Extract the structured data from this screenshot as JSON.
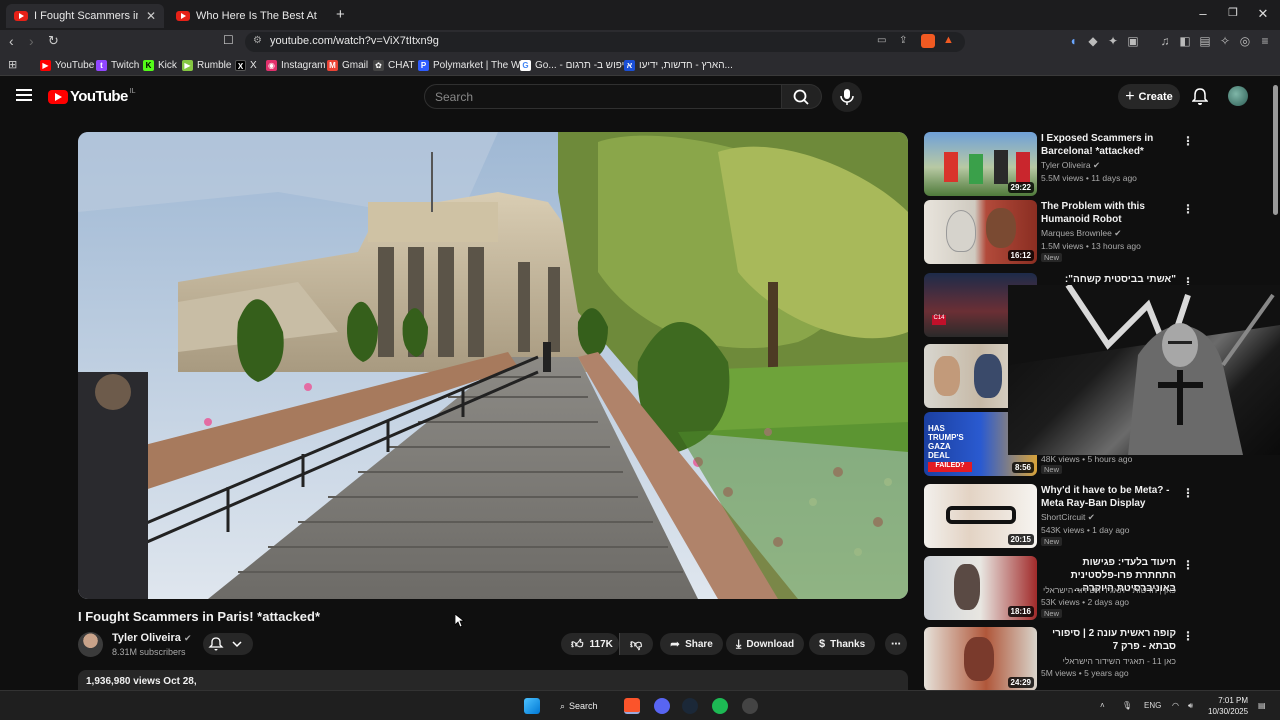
{
  "browser": {
    "tabs": [
      {
        "title": "I Fought Scammers in Paris! *",
        "active": true
      },
      {
        "title": "Who Here Is The Best At Basketball?",
        "active": false
      }
    ],
    "new_tab_glyph": "+",
    "url": "youtube.com/watch?v=ViX7tItxn9g",
    "bookmarks": [
      {
        "label": "YouTube",
        "icon": "youtube-icon",
        "color": "#ff0000"
      },
      {
        "label": "Twitch",
        "icon": "twitch-icon",
        "color": "#9146ff"
      },
      {
        "label": "Kick",
        "icon": "kick-icon",
        "color": "#53fc18"
      },
      {
        "label": "Rumble",
        "icon": "rumble-icon",
        "color": "#85c742"
      },
      {
        "label": "X",
        "icon": "x-icon",
        "color": "#000000"
      },
      {
        "label": "Instagram",
        "icon": "instagram-icon",
        "color": "#e1306c"
      },
      {
        "label": "Gmail",
        "icon": "gmail-icon",
        "color": "#ea4335"
      },
      {
        "label": "CHAT",
        "icon": "openai-icon",
        "color": "#444444"
      },
      {
        "label": "Polymarket | The W...",
        "icon": "polymarket-icon",
        "color": "#2e5cff"
      },
      {
        "label": "Go... - חיפוש ב- תרגום",
        "icon": "google-icon",
        "color": "#ffffff"
      },
      {
        "label": "הארץ - חדשות, ידיעו...",
        "icon": "haaretz-icon",
        "color": "#1a4fd6"
      }
    ]
  },
  "yt": {
    "logo_text": "YouTube",
    "country_code": "IL",
    "search_placeholder": "Search",
    "create_label": "Create"
  },
  "video": {
    "title": "I Fought Scammers in Paris! *attacked*",
    "channel": "Tyler Oliveira",
    "subscribers": "8.31M subscribers",
    "likes": "117K",
    "share_label": "Share",
    "download_label": "Download",
    "thanks_label": "Thanks",
    "views_date": "1,936,980 views  Oct 28,"
  },
  "recommendations": [
    {
      "title": "I Exposed Scammers in Barcelona! *attacked*",
      "channel": "Tyler Oliveira",
      "meta": "5.5M views • 11 days ago",
      "duration": "29:22",
      "new": false,
      "rtl": false
    },
    {
      "title": "The Problem with this Humanoid Robot",
      "channel": "Marques Brownlee",
      "meta": "1.5M views • 13 hours ago",
      "duration": "16:12",
      "new": true,
      "rtl": false
    },
    {
      "title": "\"אשתי בביסטית קשחה\": מאיר ענב...",
      "channel": "",
      "meta": "",
      "duration": "",
      "new": false,
      "rtl": true
    },
    {
      "title": "",
      "channel": "",
      "meta": "",
      "duration": "",
      "new": false,
      "rtl": false
    },
    {
      "title": "",
      "channel": "",
      "meta": "48K views • 5 hours ago",
      "duration": "8:56",
      "new": true,
      "rtl": false
    },
    {
      "title": "Why'd it have to be Meta? - Meta Ray-Ban Display",
      "channel": "ShortCircuit",
      "meta": "543K views • 1 day ago",
      "duration": "20:15",
      "new": true,
      "rtl": false
    },
    {
      "title": "תיעוד בלעדי: פגישות התחתרת פרו-פלסטינית באוניברסיטת היוקרה...",
      "channel": "כאן | חדשות - תאגיד השידור הישראלי",
      "meta": "53K views • 2 days ago",
      "duration": "18:16",
      "new": true,
      "rtl": true
    },
    {
      "title": "קופה ראשית עונה 2 | סיפורי סבתא - פרק 7",
      "channel": "כאן 11 - תאגיד השידור הישראלי",
      "meta": "5M views • 5 years ago",
      "duration": "24:29",
      "new": false,
      "rtl": true
    }
  ],
  "new_badge": "New",
  "taskbar": {
    "search_label": "Search",
    "lang": "ENG",
    "time": "7:01 PM",
    "date": "10/30/2025"
  },
  "colors": {
    "background": "#0f0f0f",
    "youtube_red": "#ff0000",
    "pill_bg": "#272727"
  }
}
